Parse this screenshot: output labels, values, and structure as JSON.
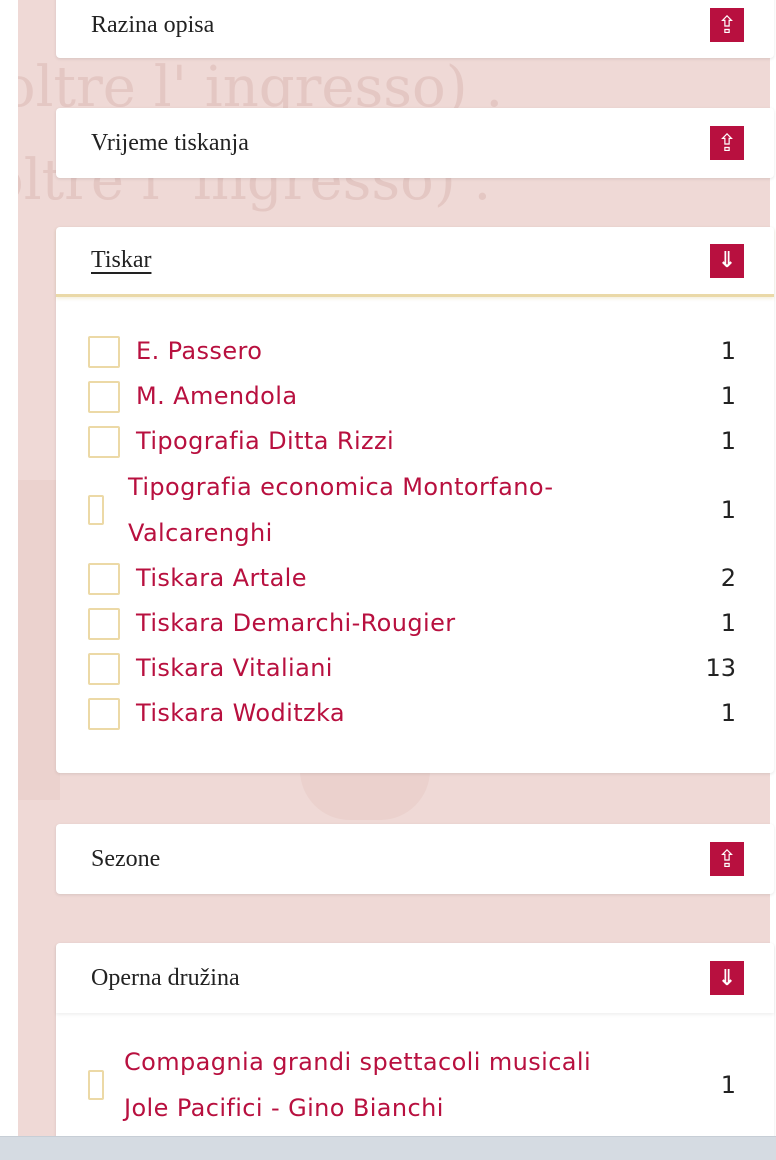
{
  "background": {
    "watermark_lines": [
      "(oltre l' ingresso) .",
      "oltre l' ingresso) ."
    ]
  },
  "colors": {
    "accent": "#b8103f",
    "checkbox_border": "#ecd9a6",
    "page_bg": "#efd9d6"
  },
  "icons": {
    "collapsed_toggle": "upwards-white-arrow-icon",
    "expanded_toggle": "double-down-arrow-icon"
  },
  "panels": {
    "razina": {
      "title": "Razina opisa",
      "toggle": "⇪"
    },
    "vrijeme": {
      "title": "Vrijeme tiskanja",
      "toggle": "⇪"
    },
    "tiskar": {
      "title": "Tiskar",
      "toggle": "⇓",
      "items": [
        {
          "label": "E. Passero",
          "count": "1"
        },
        {
          "label": "M. Amendola",
          "count": "1"
        },
        {
          "label": "Tipografia Ditta Rizzi",
          "count": "1"
        },
        {
          "label": "Tipografia economica Montorfano-Valcarenghi",
          "label_line1": "Tipografia economica Montorfano-",
          "label_line2": "Valcarenghi",
          "count": "1"
        },
        {
          "label": "Tiskara Artale",
          "count": "2"
        },
        {
          "label": "Tiskara Demarchi-Rougier",
          "count": "1"
        },
        {
          "label": "Tiskara Vitaliani",
          "count": "13"
        },
        {
          "label": "Tiskara Woditzka",
          "count": "1"
        }
      ]
    },
    "sezone": {
      "title": "Sezone",
      "toggle": "⇪"
    },
    "operna": {
      "title": "Operna družina",
      "toggle": "⇓",
      "items": [
        {
          "label": "Compagnia grandi spettacoli musicali Jole Pacifici - Gino Bianchi",
          "label_line1": "Compagnia grandi spettacoli musicali",
          "label_line2": "Jole Pacifici - Gino Bianchi",
          "count": "1"
        }
      ]
    }
  }
}
